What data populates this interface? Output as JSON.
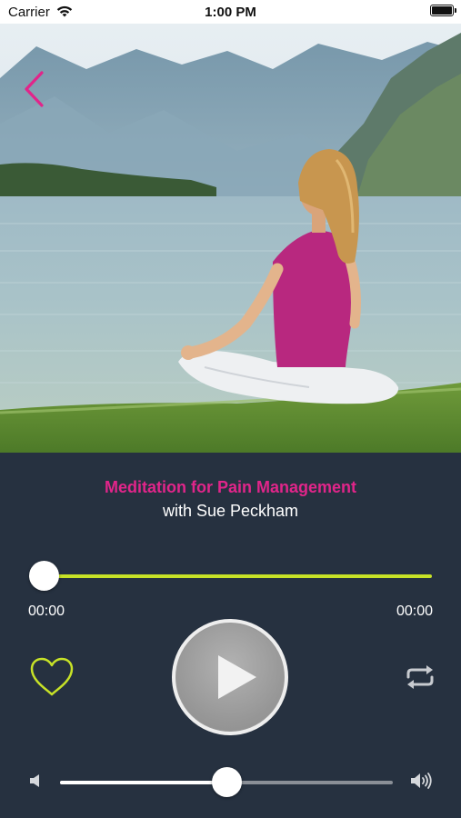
{
  "status_bar": {
    "carrier": "Carrier",
    "time": "1:00 PM",
    "wifi_icon": "wifi-icon",
    "battery_icon": "battery-icon"
  },
  "hero": {
    "image": "woman-meditating-by-lake",
    "back_icon": "chevron-left-icon"
  },
  "track": {
    "title": "Meditation for Pain Management",
    "artist": "with Sue Peckham"
  },
  "playback": {
    "elapsed": "00:00",
    "total": "00:00",
    "progress_fraction": 0.0
  },
  "controls": {
    "favorite_icon": "heart-icon",
    "play_icon": "play-icon",
    "repeat_icon": "repeat-icon"
  },
  "volume": {
    "low_icon": "speaker-low-icon",
    "high_icon": "speaker-high-icon",
    "level_fraction": 0.5
  },
  "colors": {
    "accent_pink": "#e1258a",
    "accent_lime": "#c7e227",
    "panel_bg": "#263140"
  }
}
